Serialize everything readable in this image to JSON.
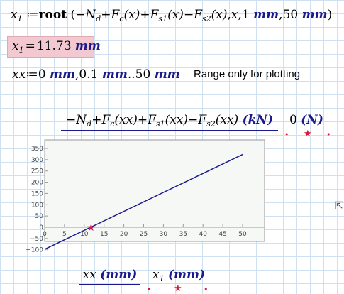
{
  "eq1": {
    "lhs": "x",
    "lhs_sub": "1",
    "assign": "≔",
    "func": "root",
    "open": "(",
    "minus1": "−",
    "Nd": "N",
    "Nd_sub": "d",
    "plus1": "+",
    "Fc": "F",
    "Fc_sub": "c",
    "Fc_arg": "(x)",
    "plus2": "+",
    "Fs1": "F",
    "Fs1_sub": "s1",
    "Fs1_arg": "(x)",
    "minus2": "−",
    "Fs2": "F",
    "Fs2_sub": "s2",
    "Fs2_arg": "(x)",
    "comma1": ",",
    "xvar": "x",
    "comma2": ",",
    "lo_val": "1",
    "lo_unit": "mm",
    "comma3": ",",
    "hi_val": "50",
    "hi_unit": "mm",
    "close": ")"
  },
  "result": {
    "var": "x",
    "sub": "1",
    "eq": "=",
    "value": "11.73",
    "unit": "mm"
  },
  "range": {
    "var": "xx",
    "assign": "≔",
    "start": "0",
    "unit1": "mm",
    "comma": ",",
    "step": "0.1",
    "unit2": "mm",
    "dots": "..",
    "end": "50",
    "unit3": "mm",
    "note": "Range only for plotting"
  },
  "plot": {
    "ylabel": {
      "minus": "−",
      "Nd": "N",
      "Nd_sub": "d",
      "plus1": "+",
      "Fc": "F",
      "Fc_sub": "c",
      "Fc_arg": "(xx)",
      "plus2": "+",
      "Fs1": "F",
      "Fs1_sub": "s1",
      "Fs1_arg": "(xx)",
      "minus2": "−",
      "Fs2": "F",
      "Fs2_sub": "s2",
      "Fs2_arg": "(xx)",
      "unit": "(kN)"
    },
    "ylabel2": {
      "value": "0",
      "unit": "(N)"
    },
    "xlabel": {
      "var": "xx",
      "unit": "(mm)"
    },
    "xlabel2": {
      "var": "x",
      "sub": "1",
      "unit": "(mm)"
    },
    "markers": {
      "dot_left": "•",
      "star": "★",
      "dot_right": "•"
    }
  },
  "chart_data": {
    "type": "line",
    "xticks": [
      "0",
      "5",
      "10",
      "15",
      "20",
      "25",
      "30",
      "35",
      "40",
      "45",
      "50"
    ],
    "yticks": [
      "350",
      "300",
      "250",
      "200",
      "150",
      "100",
      "50",
      "0",
      "−50",
      "−100"
    ],
    "xlim": [
      0,
      50
    ],
    "ylim": [
      -120,
      380
    ],
    "series": [
      {
        "type": "line",
        "color": "#1a1a8c",
        "x": [
          0,
          50
        ],
        "y": [
          -98,
          323
        ]
      },
      {
        "type": "scatter",
        "color": "#e0143c",
        "marker": "star",
        "x": [
          11.73
        ],
        "y": [
          0
        ]
      }
    ],
    "grid": false
  }
}
